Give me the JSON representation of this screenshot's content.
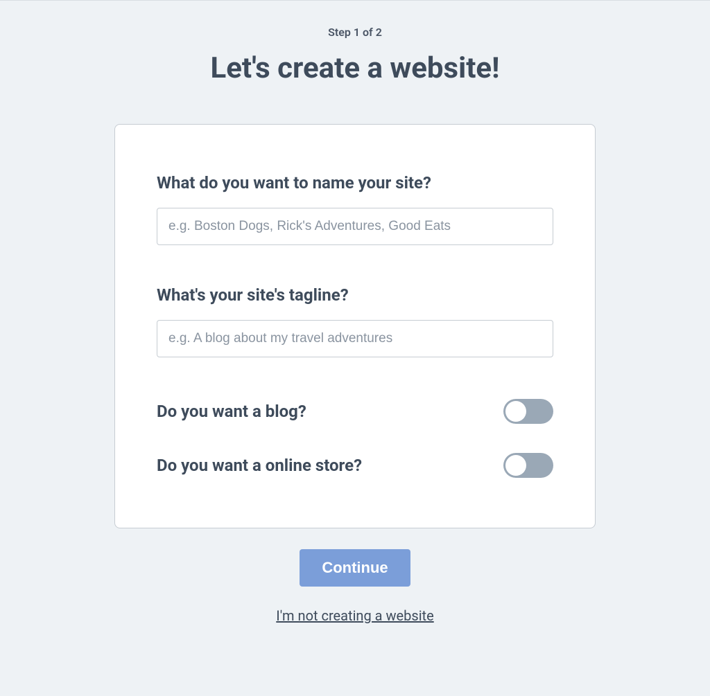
{
  "header": {
    "step_label": "Step 1 of 2",
    "heading": "Let's create a website!"
  },
  "form": {
    "site_name": {
      "label": "What do you want to name your site?",
      "placeholder": "e.g. Boston Dogs, Rick's Adventures, Good Eats",
      "value": ""
    },
    "tagline": {
      "label": "What's your site's tagline?",
      "placeholder": "e.g. A blog about my travel adventures",
      "value": ""
    },
    "blog_toggle": {
      "label": "Do you want a blog?",
      "on": false
    },
    "store_toggle": {
      "label": "Do you want a online store?",
      "on": false
    }
  },
  "actions": {
    "continue_label": "Continue",
    "skip_label": "I'm not creating a website"
  }
}
